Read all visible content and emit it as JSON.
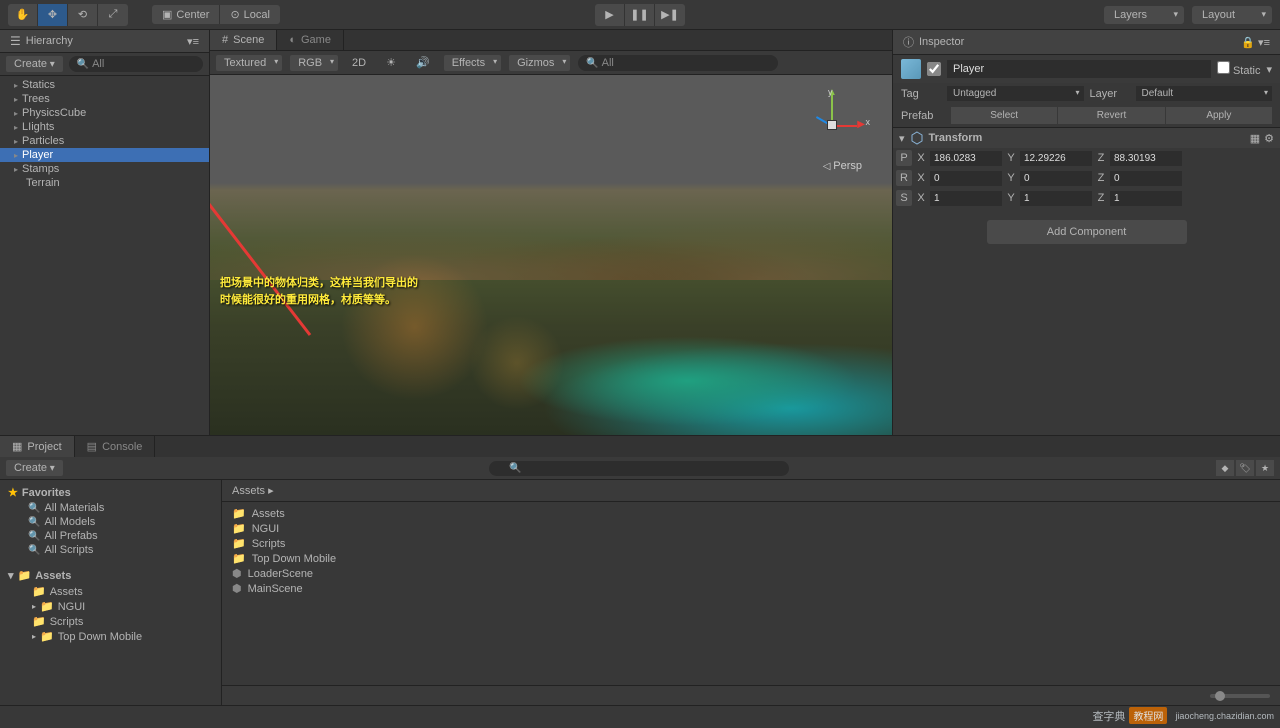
{
  "toolbar": {
    "pivot_center": "Center",
    "pivot_local": "Local",
    "layers": "Layers",
    "layout": "Layout"
  },
  "hierarchy": {
    "tab": "Hierarchy",
    "create": "Create",
    "search_placeholder": "All",
    "items": [
      {
        "label": "Statics",
        "expand": true
      },
      {
        "label": "Trees",
        "expand": true
      },
      {
        "label": "PhysicsCube",
        "expand": true
      },
      {
        "label": "LIights",
        "expand": true
      },
      {
        "label": "Particles",
        "expand": true
      },
      {
        "label": "Player",
        "expand": true,
        "selected": true
      },
      {
        "label": "Stamps",
        "expand": true
      },
      {
        "label": "Terrain",
        "expand": false
      }
    ]
  },
  "scene": {
    "tab_scene": "Scene",
    "tab_game": "Game",
    "shading": "Textured",
    "render": "RGB",
    "mode2d": "2D",
    "effects": "Effects",
    "gizmos": "Gizmos",
    "search_placeholder": "All",
    "persp": "Persp",
    "axis_x": "x",
    "axis_y": "y",
    "annotation_line1": "把场景中的物体归类，这样当我们导出的",
    "annotation_line2": "时候能很好的重用网格，材质等等。"
  },
  "inspector": {
    "tab": "Inspector",
    "name": "Player",
    "static_label": "Static",
    "tag_label": "Tag",
    "tag_value": "Untagged",
    "layer_label": "Layer",
    "layer_value": "Default",
    "prefab_label": "Prefab",
    "select_btn": "Select",
    "revert_btn": "Revert",
    "apply_btn": "Apply",
    "transform": {
      "title": "Transform",
      "p": "P",
      "r": "R",
      "s": "S",
      "x": "X",
      "y": "Y",
      "z": "Z",
      "px": "186.0283",
      "py": "12.29226",
      "pz": "88.30193",
      "rx": "0",
      "ry": "0",
      "rz": "0",
      "sx": "1",
      "sy": "1",
      "sz": "1"
    },
    "add_component": "Add Component"
  },
  "project": {
    "tab_project": "Project",
    "tab_console": "Console",
    "create": "Create",
    "favorites": "Favorites",
    "fav_items": [
      "All Materials",
      "All Models",
      "All Prefabs",
      "All Scripts"
    ],
    "assets_root": "Assets",
    "folders": [
      "Assets",
      "NGUI",
      "Scripts",
      "Top Down Mobile"
    ],
    "breadcrumb": "Assets",
    "right_items": [
      {
        "label": "Assets",
        "type": "folder"
      },
      {
        "label": "NGUI",
        "type": "folder"
      },
      {
        "label": "Scripts",
        "type": "folder"
      },
      {
        "label": "Top Down Mobile",
        "type": "folder"
      },
      {
        "label": "LoaderScene",
        "type": "scene"
      },
      {
        "label": "MainScene",
        "type": "scene"
      }
    ]
  },
  "watermark": {
    "text1": "查字典",
    "text2": "教程网",
    "url": "jiaocheng.chazidian.com"
  }
}
